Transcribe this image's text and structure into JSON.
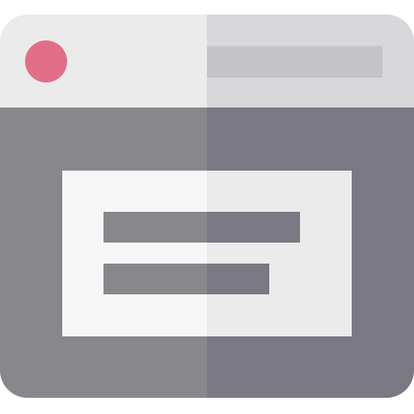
{
  "icon": {
    "name": "browser-window-icon",
    "colors": {
      "titlebar_left": "#EBEBEC",
      "titlebar_right": "#D8D8DA",
      "body_left": "#87878C",
      "body_right": "#7A7882",
      "address_bar": "#C4C4C8",
      "dot": "#E26F87",
      "card_left": "#F7F7F7",
      "card_right": "#EBEBEC",
      "line_left": "#87878C",
      "line_right": "#7A7882"
    }
  }
}
